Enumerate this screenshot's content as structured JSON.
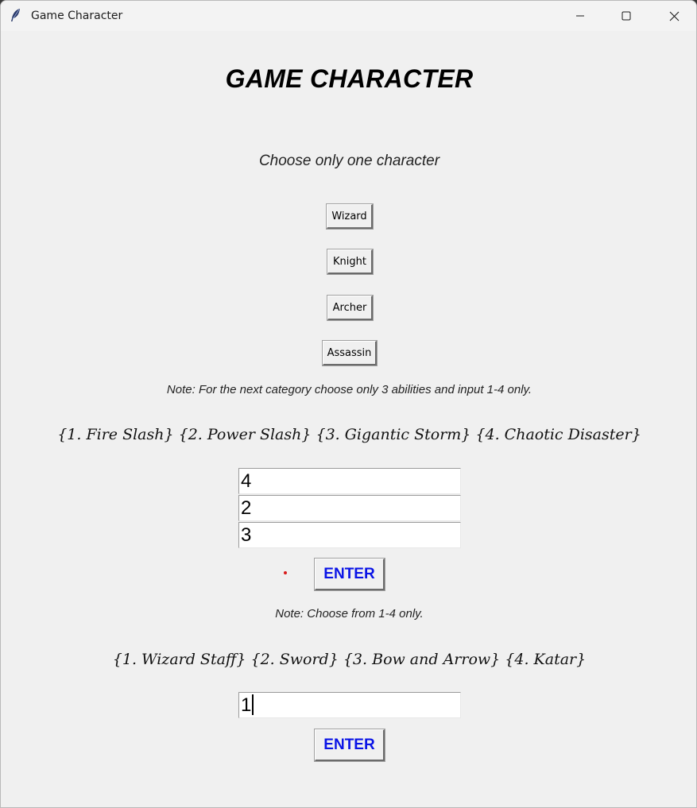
{
  "window": {
    "title": "Game Character"
  },
  "icons": {
    "app": "feather-icon",
    "minimize": "minimize-icon",
    "maximize": "maximize-icon",
    "close": "close-icon"
  },
  "colors": {
    "background": "#f0f0f0",
    "enter_text": "#0a14e6",
    "indicator_dot": "#d81a1a"
  },
  "main": {
    "heading": "GAME CHARACTER",
    "subheading": "Choose only one character",
    "characters": [
      "Wizard",
      "Knight",
      "Archer",
      "Assassin"
    ],
    "abilities_note": "Note: For the next category choose only 3 abilities and input 1-4 only.",
    "abilities_options": "{1. Fire Slash} {2. Power Slash} {3. Gigantic Storm} {4. Chaotic Disaster}",
    "ability_inputs": [
      "4",
      "2",
      "3"
    ],
    "abilities_enter_label": "ENTER",
    "weapons_note": "Note: Choose from 1-4 only.",
    "weapons_options": "{1. Wizard Staff} {2. Sword} {3. Bow and Arrow} {4. Katar}",
    "weapon_input": "1",
    "weapons_enter_label": "ENTER"
  }
}
